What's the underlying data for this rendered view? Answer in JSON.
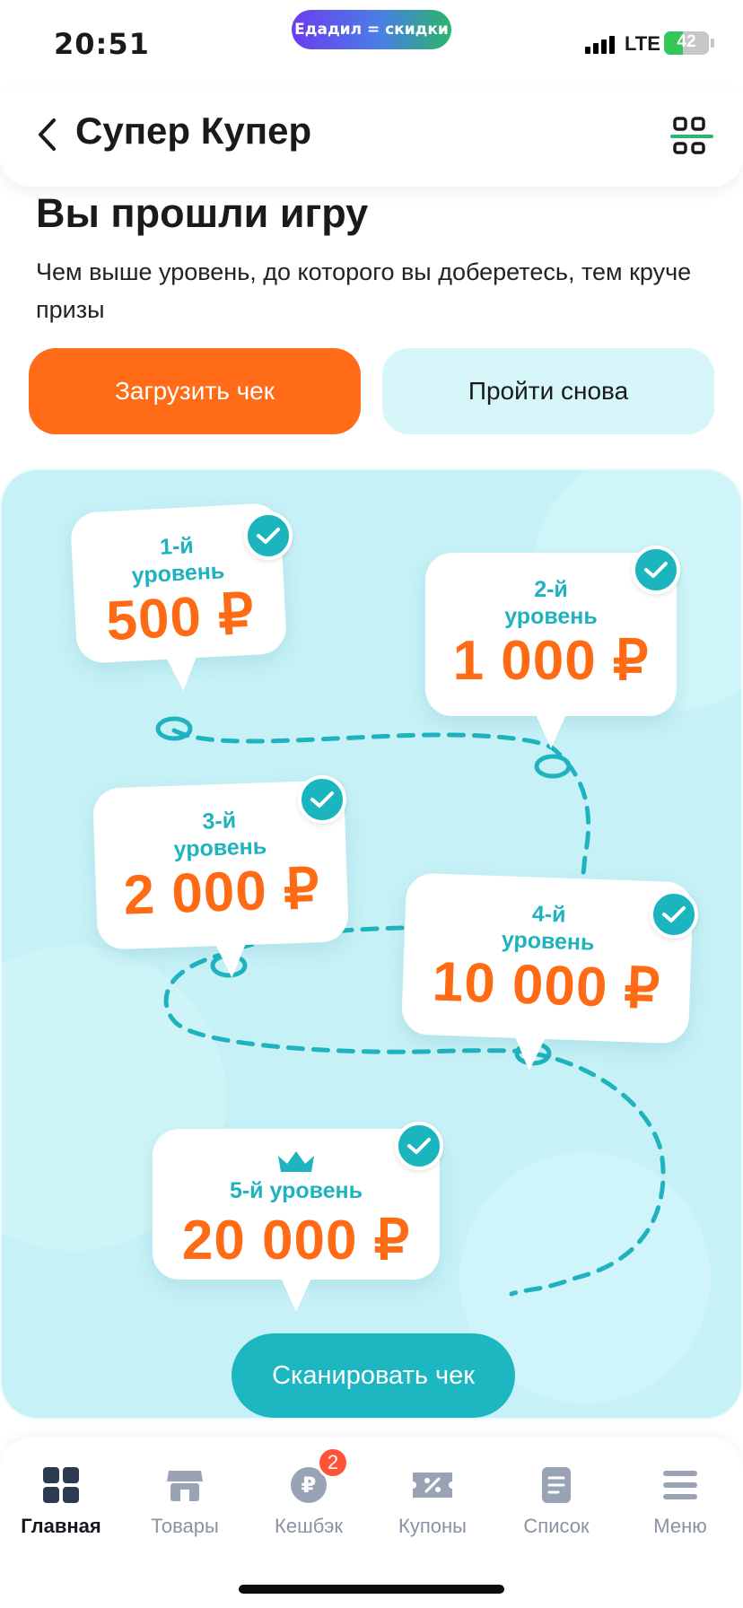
{
  "status": {
    "time": "20:51",
    "promo": "Едадил = скидки",
    "network": "LTE",
    "battery": "42",
    "battery_level": 0.42
  },
  "header": {
    "title": "Супер Купер"
  },
  "intro": {
    "title": "Вы прошли игру",
    "text": "Чем выше уровень, до которого вы доберетесь, тем круче призы",
    "upload_button": "Загрузить чек",
    "retry_button": "Пройти снова"
  },
  "levels": [
    {
      "label_line1": "1-й",
      "label_line2": "уровень",
      "amount": "500 ₽",
      "completed": true
    },
    {
      "label_line1": "2-й",
      "label_line2": "уровень",
      "amount": "1 000 ₽",
      "completed": true
    },
    {
      "label_line1": "3-й",
      "label_line2": "уровень",
      "amount": "2 000 ₽",
      "completed": true
    },
    {
      "label_line1": "4-й",
      "label_line2": "уровень",
      "amount": "10 000 ₽",
      "completed": true
    },
    {
      "label_line1": "5-й уровень",
      "label_line2": "",
      "amount": "20 000 ₽",
      "completed": true
    }
  ],
  "scan_button": "Сканировать чек",
  "nav": {
    "items": [
      {
        "label": "Главная",
        "icon": "grid-icon",
        "active": true
      },
      {
        "label": "Товары",
        "icon": "store-icon",
        "active": false
      },
      {
        "label": "Кешбэк",
        "icon": "ruble-coin-icon",
        "active": false,
        "badge": "2"
      },
      {
        "label": "Купоны",
        "icon": "coupon-icon",
        "active": false
      },
      {
        "label": "Список",
        "icon": "list-icon",
        "active": false
      },
      {
        "label": "Меню",
        "icon": "menu-icon",
        "active": false
      }
    ]
  },
  "colors": {
    "accent_orange": "#ff6b16",
    "accent_teal": "#1db7c2",
    "board_bg": "#c6f1f6"
  }
}
